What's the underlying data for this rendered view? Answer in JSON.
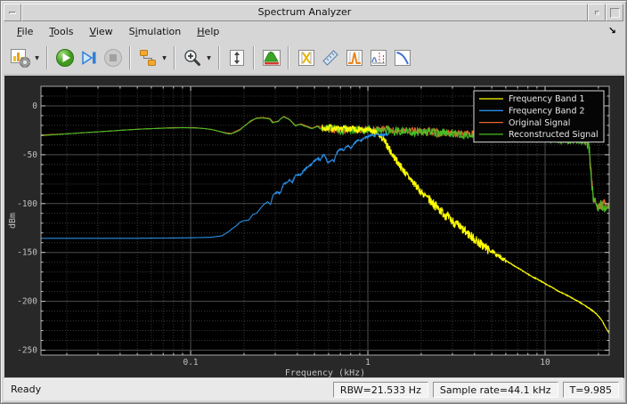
{
  "window": {
    "title": "Spectrum Analyzer"
  },
  "titlebar": {
    "buttons": [
      "window-menu",
      "minimize",
      "maximize"
    ]
  },
  "menu": {
    "items": [
      {
        "label": "File",
        "underline": 0
      },
      {
        "label": "Tools",
        "underline": 0
      },
      {
        "label": "View",
        "underline": 0
      },
      {
        "label": "Simulation",
        "underline": 1
      },
      {
        "label": "Help",
        "underline": 0
      }
    ],
    "overflow_icon": "↘"
  },
  "toolbar": {
    "buttons": [
      {
        "name": "scope-settings",
        "dropdown": true
      },
      {
        "separator": true
      },
      {
        "name": "run"
      },
      {
        "name": "step-forward"
      },
      {
        "name": "stop",
        "disabled": true
      },
      {
        "separator": true
      },
      {
        "name": "highlight-simulink-block",
        "dropdown": true
      },
      {
        "separator": true
      },
      {
        "name": "zoom-in",
        "dropdown": true
      },
      {
        "separator": true
      },
      {
        "name": "fit-to-view"
      },
      {
        "separator": true
      },
      {
        "name": "spectrum-display"
      },
      {
        "separator": true
      },
      {
        "name": "cursor-measurements"
      },
      {
        "name": "signal-statistics"
      },
      {
        "name": "peak-finder"
      },
      {
        "name": "distortion-measurements"
      },
      {
        "name": "ccdf-measurements"
      }
    ]
  },
  "status_bar": {
    "ready": "Ready",
    "fields": [
      "RBW=21.533 Hz",
      "Sample rate=44.1 kHz",
      "T=9.985"
    ]
  },
  "chart_data": {
    "type": "line",
    "xlabel": "Frequency (kHz)",
    "ylabel": "dBm",
    "x_scale": "log",
    "xlim": [
      0.0143,
      23.0
    ],
    "ylim": [
      -255,
      20
    ],
    "xticks": {
      "major": [
        0.1,
        1,
        10
      ],
      "labels": [
        "0.1",
        "1",
        "10"
      ]
    },
    "yticks": {
      "major": [
        0,
        -50,
        -100,
        -150,
        -200,
        -250
      ],
      "labels": [
        "0",
        "-50",
        "-100",
        "-150",
        "-200",
        "-250"
      ],
      "minor_step": 10
    },
    "grid": true,
    "background": "#000000",
    "legend": {
      "position": "top-right",
      "entries": [
        {
          "label": "Frequency Band 1",
          "color": "#ffff00"
        },
        {
          "label": "Frequency Band 2",
          "color": "#2a8fe8"
        },
        {
          "label": "Original Signal",
          "color": "#e8642c"
        },
        {
          "label": "Reconstructed Signal",
          "color": "#47bd24"
        }
      ]
    },
    "series": [
      {
        "name": "Original Signal",
        "color": "#e8642c",
        "seed": 21,
        "noise": [
          [
            0.55,
            17.3,
            3.8
          ],
          [
            17.3,
            23,
            5.5
          ]
        ],
        "points": [
          [
            0.0143,
            -29.8
          ],
          [
            0.02,
            -28.6
          ],
          [
            0.03,
            -26.6
          ],
          [
            0.05,
            -23.9
          ],
          [
            0.08,
            -22.3
          ],
          [
            0.105,
            -22.2
          ],
          [
            0.13,
            -24.0
          ],
          [
            0.158,
            -27.6
          ],
          [
            0.17,
            -28.2
          ],
          [
            0.19,
            -24.0
          ],
          [
            0.21,
            -18.0
          ],
          [
            0.235,
            -12.4
          ],
          [
            0.255,
            -11.9
          ],
          [
            0.28,
            -13.0
          ],
          [
            0.292,
            -16.8
          ],
          [
            0.312,
            -15.6
          ],
          [
            0.335,
            -10.8
          ],
          [
            0.36,
            -13.6
          ],
          [
            0.39,
            -20.0
          ],
          [
            0.42,
            -18.4
          ],
          [
            0.45,
            -20.6
          ],
          [
            0.485,
            -22.8
          ],
          [
            0.52,
            -20.4
          ],
          [
            0.555,
            -22.8
          ],
          [
            0.6,
            -23.8
          ],
          [
            0.7,
            -24.8
          ],
          [
            0.8,
            -24.8
          ],
          [
            0.9,
            -24.2
          ],
          [
            1.0,
            -23.2
          ],
          [
            1.2,
            -24.0
          ],
          [
            1.5,
            -25.2
          ],
          [
            2.0,
            -25.8
          ],
          [
            2.6,
            -27.8
          ],
          [
            3.5,
            -28.8
          ],
          [
            4.5,
            -29.2
          ],
          [
            6.0,
            -29.8
          ],
          [
            8.0,
            -30.8
          ],
          [
            10,
            -32.2
          ],
          [
            12,
            -33.2
          ],
          [
            14,
            -34.2
          ],
          [
            16,
            -35.2
          ],
          [
            17,
            -36.2
          ],
          [
            17.6,
            -40.2
          ],
          [
            18.0,
            -57
          ],
          [
            18.4,
            -78
          ],
          [
            18.8,
            -95
          ],
          [
            19.5,
            -101
          ],
          [
            21,
            -101
          ],
          [
            23,
            -101.5
          ]
        ]
      },
      {
        "name": "Reconstructed Signal",
        "color": "#47bd24",
        "seed": 3,
        "noise": [
          [
            0.55,
            17.3,
            4.5
          ],
          [
            17.3,
            18.8,
            9
          ],
          [
            18.8,
            23,
            6
          ]
        ],
        "points": [
          [
            0.0143,
            -30.5
          ],
          [
            0.018,
            -29.2
          ],
          [
            0.024,
            -27.6
          ],
          [
            0.032,
            -26.2
          ],
          [
            0.042,
            -24.8
          ],
          [
            0.055,
            -23.6
          ],
          [
            0.07,
            -22.9
          ],
          [
            0.09,
            -22.4
          ],
          [
            0.105,
            -22.6
          ],
          [
            0.12,
            -23.2
          ],
          [
            0.135,
            -24.6
          ],
          [
            0.148,
            -26.6
          ],
          [
            0.158,
            -28.2
          ],
          [
            0.168,
            -28.8
          ],
          [
            0.178,
            -27.2
          ],
          [
            0.19,
            -24.6
          ],
          [
            0.205,
            -19.5
          ],
          [
            0.22,
            -14.8
          ],
          [
            0.235,
            -12.9
          ],
          [
            0.252,
            -12.4
          ],
          [
            0.268,
            -12.9
          ],
          [
            0.28,
            -13.6
          ],
          [
            0.29,
            -17.4
          ],
          [
            0.3,
            -16.6
          ],
          [
            0.312,
            -16.1
          ],
          [
            0.322,
            -13.2
          ],
          [
            0.334,
            -11.3
          ],
          [
            0.348,
            -12.6
          ],
          [
            0.362,
            -14.2
          ],
          [
            0.378,
            -18.0
          ],
          [
            0.39,
            -20.6
          ],
          [
            0.405,
            -19.4
          ],
          [
            0.42,
            -19.0
          ],
          [
            0.435,
            -20.6
          ],
          [
            0.45,
            -21.2
          ],
          [
            0.468,
            -22.6
          ],
          [
            0.485,
            -23.4
          ],
          [
            0.5,
            -22.2
          ],
          [
            0.52,
            -21.0
          ],
          [
            0.54,
            -23.8
          ],
          [
            0.565,
            -22.0
          ],
          [
            0.6,
            -24.5
          ],
          [
            0.65,
            -23.0
          ],
          [
            0.7,
            -25.5
          ],
          [
            0.75,
            -23.5
          ],
          [
            0.8,
            -25.5
          ],
          [
            0.85,
            -23.0
          ],
          [
            0.9,
            -25.0
          ],
          [
            1.0,
            -24.0
          ],
          [
            1.1,
            -25.5
          ],
          [
            1.25,
            -24.5
          ],
          [
            1.4,
            -26.5
          ],
          [
            1.6,
            -25.5
          ],
          [
            1.8,
            -27.5
          ],
          [
            2.0,
            -26.5
          ],
          [
            2.3,
            -27.5
          ],
          [
            2.6,
            -28.5
          ],
          [
            3.0,
            -27.5
          ],
          [
            3.5,
            -29.5
          ],
          [
            4.0,
            -28.5
          ],
          [
            4.5,
            -30.0
          ],
          [
            5.0,
            -29.5
          ],
          [
            6.0,
            -30.5
          ],
          [
            7.0,
            -31.5
          ],
          [
            8.0,
            -31.5
          ],
          [
            9.0,
            -32.5
          ],
          [
            10,
            -33.0
          ],
          [
            11,
            -33.5
          ],
          [
            12,
            -34.0
          ],
          [
            13,
            -34.5
          ],
          [
            14,
            -35.0
          ],
          [
            15,
            -35.5
          ],
          [
            16,
            -36.0
          ],
          [
            17,
            -37.0
          ],
          [
            17.6,
            -41.0
          ],
          [
            17.9,
            -52.0
          ],
          [
            18.2,
            -68.0
          ],
          [
            18.5,
            -84.0
          ],
          [
            18.8,
            -96.0
          ],
          [
            19.2,
            -101.0
          ],
          [
            20,
            -102.5
          ],
          [
            21,
            -101.5
          ],
          [
            22,
            -103.0
          ],
          [
            23,
            -102.0
          ]
        ]
      },
      {
        "name": "Frequency Band 1",
        "color": "#ffff00",
        "seed": 7,
        "noise": [
          [
            0.55,
            1.2,
            3.0
          ],
          [
            1.2,
            2.2,
            4.0
          ],
          [
            2.2,
            4.8,
            5.0
          ],
          [
            4.8,
            6.0,
            2.0
          ],
          [
            6.0,
            23,
            0.4
          ]
        ],
        "points": [
          [
            0.55,
            -22
          ],
          [
            0.58,
            -24
          ],
          [
            0.61,
            -21
          ],
          [
            0.64,
            -24
          ],
          [
            0.67,
            -22
          ],
          [
            0.7,
            -25
          ],
          [
            0.74,
            -22
          ],
          [
            0.78,
            -25
          ],
          [
            0.82,
            -23
          ],
          [
            0.86,
            -25
          ],
          [
            0.9,
            -23
          ],
          [
            0.95,
            -26
          ],
          [
            1.0,
            -24
          ],
          [
            1.05,
            -26
          ],
          [
            1.1,
            -27
          ],
          [
            1.15,
            -30
          ],
          [
            1.2,
            -33
          ],
          [
            1.26,
            -38
          ],
          [
            1.33,
            -45
          ],
          [
            1.4,
            -52
          ],
          [
            1.48,
            -58
          ],
          [
            1.56,
            -64
          ],
          [
            1.65,
            -70
          ],
          [
            1.74,
            -75
          ],
          [
            1.85,
            -81
          ],
          [
            1.97,
            -87
          ],
          [
            2.1,
            -92
          ],
          [
            2.25,
            -97
          ],
          [
            2.4,
            -102
          ],
          [
            2.6,
            -108
          ],
          [
            2.8,
            -113
          ],
          [
            3.0,
            -118
          ],
          [
            3.25,
            -123
          ],
          [
            3.5,
            -128
          ],
          [
            3.8,
            -133
          ],
          [
            4.1,
            -138
          ],
          [
            4.45,
            -143
          ],
          [
            4.8,
            -147
          ],
          [
            5.2,
            -151
          ],
          [
            5.6,
            -155
          ],
          [
            6.1,
            -159
          ],
          [
            6.6,
            -163
          ],
          [
            7.2,
            -167
          ],
          [
            7.8,
            -171
          ],
          [
            8.5,
            -175
          ],
          [
            9.2,
            -178
          ],
          [
            10,
            -182
          ],
          [
            11,
            -186
          ],
          [
            12,
            -190
          ],
          [
            13,
            -193
          ],
          [
            14,
            -196
          ],
          [
            15,
            -199
          ],
          [
            16,
            -202
          ],
          [
            17,
            -205
          ],
          [
            18,
            -208
          ],
          [
            19,
            -211
          ],
          [
            20,
            -215
          ],
          [
            21,
            -220
          ],
          [
            22,
            -227
          ],
          [
            23,
            -233
          ]
        ]
      },
      {
        "name": "Frequency Band 2",
        "color": "#2a8fe8",
        "seed": 11,
        "noise": [
          [
            0.3,
            1.3,
            0.8
          ]
        ],
        "points": [
          [
            0.0143,
            -135.5
          ],
          [
            0.05,
            -135.5
          ],
          [
            0.1,
            -135
          ],
          [
            0.13,
            -134.5
          ],
          [
            0.15,
            -133
          ],
          [
            0.163,
            -129
          ],
          [
            0.172,
            -125.5
          ],
          [
            0.18,
            -123
          ],
          [
            0.19,
            -119
          ],
          [
            0.2,
            -117.5
          ],
          [
            0.212,
            -117
          ],
          [
            0.225,
            -111
          ],
          [
            0.235,
            -110
          ],
          [
            0.25,
            -104
          ],
          [
            0.262,
            -100
          ],
          [
            0.272,
            -98
          ],
          [
            0.282,
            -101
          ],
          [
            0.292,
            -91
          ],
          [
            0.305,
            -88.5
          ],
          [
            0.32,
            -89.5
          ],
          [
            0.335,
            -80
          ],
          [
            0.35,
            -78
          ],
          [
            0.362,
            -75.5
          ],
          [
            0.375,
            -78
          ],
          [
            0.39,
            -71.5
          ],
          [
            0.405,
            -70.5
          ],
          [
            0.42,
            -70
          ],
          [
            0.435,
            -66
          ],
          [
            0.45,
            -63.5
          ],
          [
            0.465,
            -62
          ],
          [
            0.48,
            -60
          ],
          [
            0.495,
            -57
          ],
          [
            0.51,
            -55
          ],
          [
            0.525,
            -54
          ],
          [
            0.54,
            -56
          ],
          [
            0.555,
            -51
          ],
          [
            0.565,
            -50
          ],
          [
            0.578,
            -53
          ],
          [
            0.59,
            -57
          ],
          [
            0.6,
            -58
          ],
          [
            0.615,
            -57
          ],
          [
            0.63,
            -55
          ],
          [
            0.645,
            -57
          ],
          [
            0.66,
            -50
          ],
          [
            0.675,
            -47
          ],
          [
            0.69,
            -45
          ],
          [
            0.71,
            -44
          ],
          [
            0.73,
            -46
          ],
          [
            0.75,
            -42
          ],
          [
            0.775,
            -40.5
          ],
          [
            0.8,
            -44
          ],
          [
            0.82,
            -41
          ],
          [
            0.84,
            -38
          ],
          [
            0.865,
            -36
          ],
          [
            0.89,
            -34.5
          ],
          [
            0.92,
            -35.5
          ],
          [
            0.95,
            -33
          ],
          [
            0.98,
            -32
          ],
          [
            1.01,
            -31.5
          ],
          [
            1.05,
            -29.5
          ],
          [
            1.09,
            -31
          ],
          [
            1.13,
            -28.5
          ],
          [
            1.18,
            -30
          ],
          [
            1.3,
            -29
          ]
        ]
      }
    ]
  }
}
